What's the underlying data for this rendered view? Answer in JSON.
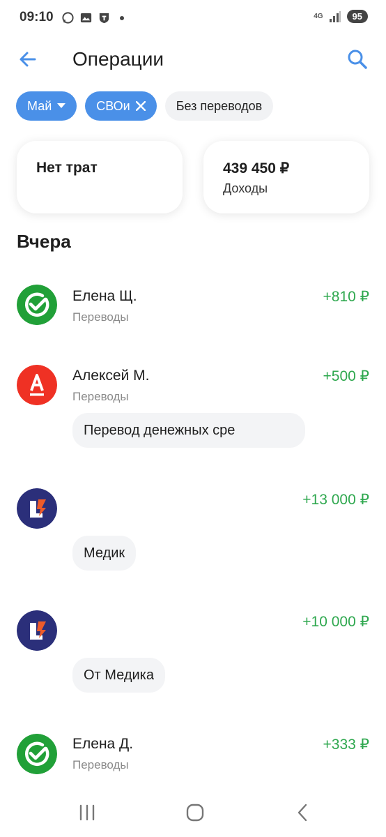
{
  "status_bar": {
    "time": "09:10",
    "network": "4G",
    "battery": "95",
    "icons": [
      "whatsapp-icon",
      "gallery-icon",
      "shield-app-icon"
    ]
  },
  "header": {
    "title": "Операции",
    "back_icon": "arrow-left-icon",
    "search_icon": "search-icon"
  },
  "filters": {
    "month": "Май",
    "category": "СВОи",
    "transfers": "Без переводов"
  },
  "summary": {
    "expenses_label": "Нет трат",
    "income_amount": "439 450 ₽",
    "income_label": "Доходы"
  },
  "section": {
    "title": "Вчера"
  },
  "transactions": [
    {
      "name": "Елена Щ.",
      "category": "Переводы",
      "amount": "+810 ₽",
      "bank": "sber"
    },
    {
      "name": "Алексей М.",
      "category": "Переводы",
      "amount": "+500 ₽",
      "note": "Перевод денежных сре",
      "bank": "alfa"
    },
    {
      "name": "",
      "category": "",
      "amount": "+13 000 ₽",
      "note": "Медик",
      "bank": "other"
    },
    {
      "name": "",
      "category": "",
      "amount": "+10 000 ₽",
      "note": "От Медика",
      "bank": "other"
    },
    {
      "name": "Елена Д.",
      "category": "Переводы",
      "amount": "+333 ₽",
      "bank": "sber"
    }
  ],
  "colors": {
    "accent": "#4a90e8",
    "income": "#2fa84f",
    "sber": "#21a038",
    "alfa": "#ef3124",
    "other_bank": "#2b2f7a"
  }
}
